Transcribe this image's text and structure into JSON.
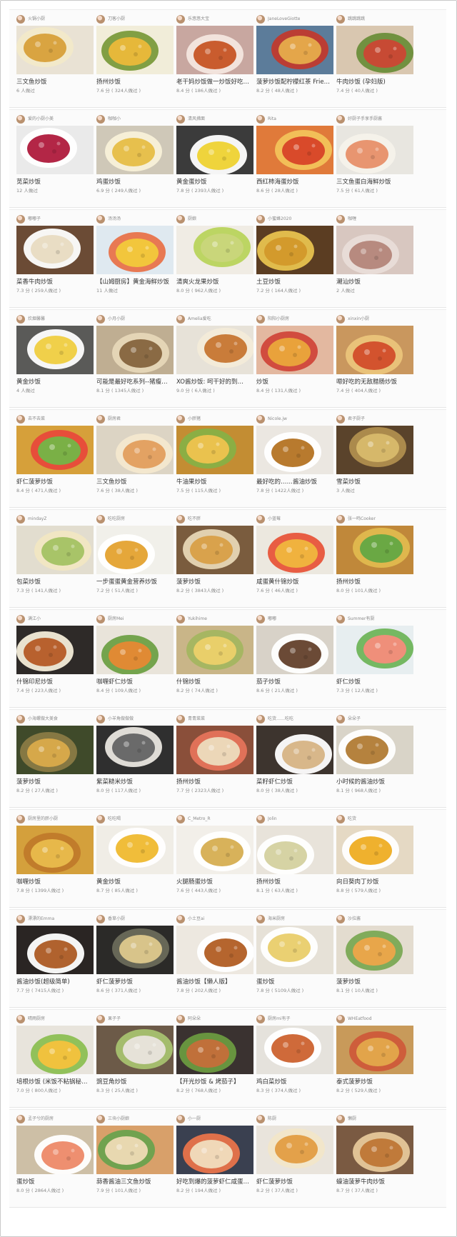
{
  "sections": [
    {
      "cards": [
        {
          "author": "火锅小厨",
          "title": "三文鱼炒饭",
          "meta": "6 人做过",
          "colors": [
            "#e9e2d4",
            "#d9a441",
            "#f2e9c9"
          ]
        },
        {
          "author": "刀客小厨",
          "title": "扬州炒饭",
          "meta": "7.6 分 ( 324人做过 )",
          "colors": [
            "#f1edd9",
            "#e6b83a",
            "#7a9b3c"
          ]
        },
        {
          "author": "乐悠悠大宝",
          "title": "老干妈炒饭做一炒饭好吃…",
          "meta": "8.4 分 ( 186人做过 )",
          "colors": [
            "#c8a7a0",
            "#c95c2e",
            "#f4e6df"
          ]
        },
        {
          "author": "JaneLoveGiotte",
          "title": "菠萝炒饭配柠檬红茶 Frie…",
          "meta": "8.2 分 ( 48人做过 )",
          "colors": [
            "#5c7c9a",
            "#e4a64a",
            "#c03a2e"
          ]
        },
        {
          "author": "跳跳跳跳",
          "title": "牛肉炒饭 (孕妇版)",
          "meta": "7.4 分 ( 40人做过 )",
          "colors": [
            "#d9c7b0",
            "#c74a34",
            "#6b8e3a"
          ]
        }
      ]
    },
    {
      "cards": [
        {
          "author": "爱的小厨小美",
          "title": "苋菜炒饭",
          "meta": "12 人做过",
          "colors": [
            "#eaeaea",
            "#b32646",
            "#ffffff"
          ]
        },
        {
          "author": "咖咖小",
          "title": "鸡蛋炒饭",
          "meta": "6.9 分 ( 249人做过 )",
          "colors": [
            "#cfc8b8",
            "#e7c04d",
            "#f8f1d8"
          ]
        },
        {
          "author": "清风拂面",
          "title": "黄金蛋炒饭",
          "meta": "7.8 分 ( 2393人做过 )",
          "colors": [
            "#3b3b3b",
            "#efd43c",
            "#ffffff"
          ]
        },
        {
          "author": "Rita",
          "title": "西红柿海蛋炒饭",
          "meta": "8.6 分 ( 28人做过 )",
          "colors": [
            "#e07a3a",
            "#d94a2a",
            "#f2c35a"
          ]
        },
        {
          "author": "好厨子手享手厨酱",
          "title": "三文鱼蛋白海鲜炒饭",
          "meta": "7.5 分 ( 61人做过 )",
          "colors": [
            "#e8e6e0",
            "#e89570",
            "#f5f2ea"
          ]
        }
      ]
    },
    {
      "cards": [
        {
          "author": "嘟嘟子",
          "title": "菜香牛肉炒饭",
          "meta": "7.3 分 ( 259人做过 )",
          "colors": [
            "#6b4b35",
            "#e9ddc4",
            "#ffffff"
          ]
        },
        {
          "author": "汤汤汤",
          "title": "【山姆厨房】黄金海鲜炒饭",
          "meta": "11 人做过",
          "colors": [
            "#dfe9f0",
            "#f2c63c",
            "#e8734a"
          ]
        },
        {
          "author": "厨娘",
          "title": "清爽火龙果炒饭",
          "meta": "8.0 分 ( 962人做过 )",
          "colors": [
            "#f0ece4",
            "#c9d67a",
            "#b8d45c"
          ]
        },
        {
          "author": "小蜜蜂2020",
          "title": "土豆炒饭",
          "meta": "7.2 分 ( 164人做过 )",
          "colors": [
            "#5b3d22",
            "#d39a2c",
            "#e8c24f"
          ]
        },
        {
          "author": "咖喱",
          "title": "潮汕炒饭",
          "meta": "2 人做过",
          "colors": [
            "#d8c7c0",
            "#b78a7f",
            "#e9ddd8"
          ]
        }
      ]
    },
    {
      "cards": [
        {
          "author": "炊烟馨馨",
          "title": "黄金炒饭",
          "meta": "4 人做过",
          "colors": [
            "#5a5a58",
            "#f0d04a",
            "#ffffff"
          ]
        },
        {
          "author": "小月小厨",
          "title": "可能是最好吃系列--猪瘦…",
          "meta": "8.1 分 ( 1345人做过 )",
          "colors": [
            "#bfae92",
            "#8a6a44",
            "#e6d7b8"
          ]
        },
        {
          "author": "Amelia爱吃",
          "title": "XO酱炒饭: 呵干好的到…",
          "meta": "9.0 分 ( 6人做过 )",
          "colors": [
            "#e7e2d8",
            "#c97c3a",
            "#f3ebd9"
          ]
        },
        {
          "author": "阳阳小厨房",
          "title": "炒饭",
          "meta": "8.4 分 ( 131人做过 )",
          "colors": [
            "#e3b8a0",
            "#e9a23b",
            "#d0463a"
          ]
        },
        {
          "author": "xinxin小厨",
          "title": "嗯好吃的无敌腊肠炒饭",
          "meta": "7.4 分 ( 404人做过 )",
          "colors": [
            "#c9975e",
            "#d3532e",
            "#ebc47a"
          ]
        }
      ]
    },
    {
      "cards": [
        {
          "author": "去不去菜",
          "title": "虾仁菠萝炒饭",
          "meta": "8.4 分 ( 471人做过 )",
          "colors": [
            "#d6a03a",
            "#7ab046",
            "#e84a3a"
          ]
        },
        {
          "author": "厨房君",
          "title": "三文鱼炒饭",
          "meta": "7.6 分 ( 38人做过 )",
          "colors": [
            "#dcd4c4",
            "#e3a263",
            "#f3e8cf"
          ]
        },
        {
          "author": "小胖猪",
          "title": "牛油果炒饭",
          "meta": "7.5 分 ( 115人做过 )",
          "colors": [
            "#c38d33",
            "#eac24e",
            "#88b046"
          ]
        },
        {
          "author": "Nicole.jw",
          "title": "最好吃的……酱油炒饭",
          "meta": "7.8 分 ( 1422人做过 )",
          "colors": [
            "#ebe7e1",
            "#b87a2e",
            "#ffffff"
          ]
        },
        {
          "author": "君子厨子",
          "title": "雪菜炒饭",
          "meta": "3 人做过",
          "colors": [
            "#5a432b",
            "#d6b86a",
            "#b08e4e"
          ]
        }
      ]
    },
    {
      "cards": [
        {
          "author": "mindayZ",
          "title": "包菜炒饭",
          "meta": "7.3 分 ( 141人做过 )",
          "colors": [
            "#e2ddcf",
            "#a8c468",
            "#f1e6c2"
          ]
        },
        {
          "author": "吃吃厨房",
          "title": "一步蛋蛋黄金营养炒饭",
          "meta": "7.2 分 ( 51人做过 )",
          "colors": [
            "#f1f0ea",
            "#e5a73a",
            "#ffffff"
          ]
        },
        {
          "author": "吃不胖",
          "title": "菠萝炒饭",
          "meta": "8.2 分 ( 3843人做过 )",
          "colors": [
            "#7a5c3e",
            "#d9a24c",
            "#e7d6b5"
          ]
        },
        {
          "author": "小蓝莓",
          "title": "咸蛋黄什锦炒饭",
          "meta": "7.6 分 ( 46人做过 )",
          "colors": [
            "#ece8df",
            "#f0b23e",
            "#e8553a"
          ]
        },
        {
          "author": "张一鸣Cooker",
          "title": "扬州炒饭",
          "meta": "8.0 分 ( 101人做过 )",
          "colors": [
            "#c0883a",
            "#6aa844",
            "#e0b94e"
          ]
        }
      ]
    },
    {
      "cards": [
        {
          "author": "满江小",
          "title": "什锦印尼炒饭",
          "meta": "7.4 分 ( 223人做过 )",
          "colors": [
            "#2e2a28",
            "#b8612e",
            "#f3ecd8"
          ]
        },
        {
          "author": "厨房Mei",
          "title": "咖喱虾仁炒饭",
          "meta": "8.4 分 ( 109人做过 )",
          "colors": [
            "#e9e4da",
            "#e08a34",
            "#6ea046"
          ]
        },
        {
          "author": "Yukihime",
          "title": "什锦炒饭",
          "meta": "8.2 分 ( 74人做过 )",
          "colors": [
            "#c9b588",
            "#e9cf6a",
            "#a4b660"
          ]
        },
        {
          "author": "嘟嘟",
          "title": "茄子炒饭",
          "meta": "8.6 分 ( 21人做过 )",
          "colors": [
            "#d8d2c8",
            "#6b4a36",
            "#ffffff"
          ]
        },
        {
          "author": "Summer有厨",
          "title": "虾仁炒饭",
          "meta": "7.3 分 ( 12人做过 )",
          "colors": [
            "#e7eef0",
            "#ef8f7a",
            "#6fb45a"
          ]
        }
      ]
    },
    {
      "cards": [
        {
          "author": "小海螺做大美食",
          "title": "菠萝炒饭",
          "meta": "8.2 分 ( 27人做过 )",
          "colors": [
            "#3f4a2a",
            "#d6a84a",
            "#8a7a44"
          ]
        },
        {
          "author": "小羊角做做做",
          "title": "紫菜糙米炒饭",
          "meta": "8.0 分 ( 117人做过 )",
          "colors": [
            "#2f2f2f",
            "#6a6a6a",
            "#e9e6df"
          ]
        },
        {
          "author": "青青菜菜",
          "title": "扬州炒饭",
          "meta": "7.7 分 ( 2323人做过 )",
          "colors": [
            "#8a4f3a",
            "#ecd7b8",
            "#e5735a"
          ]
        },
        {
          "author": "吃货……吃吃",
          "title": "菜籽虾仁炒饭",
          "meta": "8.0 分 ( 38人做过 )",
          "colors": [
            "#3d342e",
            "#d8b78a",
            "#ffffff"
          ]
        },
        {
          "author": "朵朵子",
          "title": "小时候的酱油炒饭",
          "meta": "8.1 分 ( 968人做过 )",
          "colors": [
            "#d9d4c8",
            "#b5823e",
            "#ffffff"
          ]
        }
      ]
    },
    {
      "cards": [
        {
          "author": "厨房里的胖小厨",
          "title": "咖喱炒饭",
          "meta": "7.8 分 ( 1399人做过 )",
          "colors": [
            "#d4a03c",
            "#e7b84a",
            "#c07a2a"
          ]
        },
        {
          "author": "吃吃喝",
          "title": "黄金炒饭",
          "meta": "8.7 分 ( 85人做过 )",
          "colors": [
            "#f0ede6",
            "#f0bd3a",
            "#ffffff"
          ]
        },
        {
          "author": "C_Metro_R",
          "title": "火腿肠蛋炒饭",
          "meta": "7.6 分 ( 443人做过 )",
          "colors": [
            "#f2efe9",
            "#d8b25a",
            "#ffffff"
          ]
        },
        {
          "author": "Jolin",
          "title": "扬州炒饭",
          "meta": "8.1 分 ( 63人做过 )",
          "colors": [
            "#e8e3da",
            "#d6d3a4",
            "#ffffff"
          ]
        },
        {
          "author": "吃货",
          "title": "向日葵肉丁炒饭",
          "meta": "8.8 分 ( 579人做过 )",
          "colors": [
            "#e5d9c4",
            "#efb12e",
            "#ffffff"
          ]
        }
      ]
    },
    {
      "cards": [
        {
          "author": "漂漂的Emma",
          "title": "酱油炒饭(超级简单)",
          "meta": "7.7 分 ( 7415人做过 )",
          "colors": [
            "#2a2523",
            "#b0622e",
            "#ffffff"
          ]
        },
        {
          "author": "香草小厨",
          "title": "虾仁菠萝炒饭",
          "meta": "8.6 分 ( 371人做过 )",
          "colors": [
            "#2b2a28",
            "#d8c48a",
            "#6a6a5a"
          ]
        },
        {
          "author": "小土豆ai",
          "title": "酱油炒饭【懒人版】",
          "meta": "7.8 分 ( 202人做过 )",
          "colors": [
            "#ede8e0",
            "#b5652e",
            "#ffffff"
          ]
        },
        {
          "author": "海米厨房",
          "title": "蛋炒饭",
          "meta": "7.8 分 ( 5109人做过 )",
          "colors": [
            "#e6e1d7",
            "#ead072",
            "#ffffff"
          ]
        },
        {
          "author": "沙拉酱",
          "title": "菠萝炒饭",
          "meta": "8.1 分 ( 10人做过 )",
          "colors": [
            "#e3dccf",
            "#e8a64a",
            "#7aa854"
          ]
        }
      ]
    },
    {
      "cards": [
        {
          "author": "晴雨厨房",
          "title": "培根炒饭 (米饭不粘锅秘…",
          "meta": "7.0 分 ( 800人做过 )",
          "colors": [
            "#e8e4dc",
            "#f0c23e",
            "#8cbf52"
          ]
        },
        {
          "author": "果子子",
          "title": "豌豆角炒饭",
          "meta": "8.3 分 ( 25人做过 )",
          "colors": [
            "#6c5a48",
            "#e6e2d8",
            "#a8c270"
          ]
        },
        {
          "author": "阿朵朵",
          "title": "【开光炒饭 & 烤茄子】",
          "meta": "8.2 分 ( 768人做过 )",
          "colors": [
            "#3a3230",
            "#c0703a",
            "#6a9a40"
          ]
        },
        {
          "author": "厨房mi有子",
          "title": "鸡白菜炒饭",
          "meta": "8.3 分 ( 374人做过 )",
          "colors": [
            "#e5e2dc",
            "#cf6a3a",
            "#ffffff"
          ]
        },
        {
          "author": "WHEatfood",
          "title": "泰式菠萝炒饭",
          "meta": "8.2 分 ( 529人做过 )",
          "colors": [
            "#c89a5a",
            "#e2a44a",
            "#cf5a3a"
          ]
        }
      ]
    },
    {
      "cards": [
        {
          "author": "孟子兮的厨房",
          "title": "蛋炒饭",
          "meta": "8.0 分 ( 2864人做过 )",
          "colors": [
            "#cdbfa6",
            "#ee8f70",
            "#ffffff"
          ]
        },
        {
          "author": "三块小厨娘",
          "title": "蒜香酱油三文鱼炒饭",
          "meta": "7.9 分 ( 101人做过 )",
          "colors": [
            "#d8a06a",
            "#e8d8b0",
            "#6aa24e"
          ]
        },
        {
          "author": "小一厨",
          "title": "好吃到爆的菠萝虾仁咸蛋…",
          "meta": "8.2 分 ( 194人做过 )",
          "colors": [
            "#3a4050",
            "#f0d8b8",
            "#e8734a"
          ]
        },
        {
          "author": "陈厨",
          "title": "虾仁菠萝炒饭",
          "meta": "8.2 分 ( 37人做过 )",
          "colors": [
            "#e9e4dc",
            "#e3a14a",
            "#f2e6c8"
          ]
        },
        {
          "author": "懒厨",
          "title": "蠔油菠萝牛肉炒饭",
          "meta": "8.7 分 ( 37人做过 )",
          "colors": [
            "#7a5a42",
            "#c07a3a",
            "#e6c89a"
          ]
        }
      ]
    }
  ]
}
